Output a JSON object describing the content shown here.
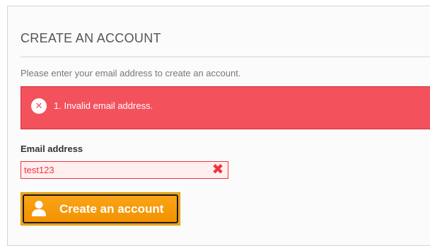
{
  "form": {
    "heading": "CREATE AN ACCOUNT",
    "intro": "Please enter your email address to create an account.",
    "error_message": "1. Invalid email address.",
    "email_label": "Email address",
    "email_value": "test123",
    "submit_label": "Create an account"
  },
  "icons": {
    "alert": "error-circle-icon",
    "field_error": "close-x-icon",
    "submit": "user-icon"
  },
  "colors": {
    "alert_background": "#f3515c",
    "field_error": "#f13340",
    "button_background": "#f9a418"
  }
}
